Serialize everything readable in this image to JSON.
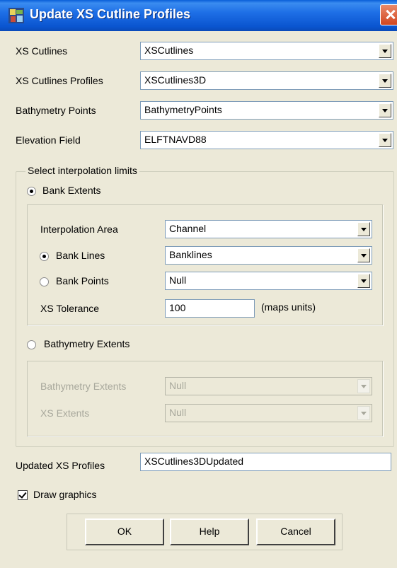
{
  "window": {
    "title": "Update XS Cutline Profiles"
  },
  "fields": {
    "xs_cutlines": {
      "label": "XS Cutlines",
      "value": "XSCutlines"
    },
    "xs_cutlines_profiles": {
      "label": "XS Cutlines Profiles",
      "value": "XSCutlines3D"
    },
    "bathymetry_points": {
      "label": "Bathymetry Points",
      "value": "BathymetryPoints"
    },
    "elevation_field": {
      "label": "Elevation Field",
      "value": "ELFTNAVD88"
    }
  },
  "interpolation": {
    "group_label": "Select interpolation limits",
    "bank_extents": {
      "label": "Bank Extents",
      "selected": true,
      "interpolation_area": {
        "label": "Interpolation Area",
        "value": "Channel"
      },
      "bank_lines": {
        "label": "Bank Lines",
        "value": "Banklines",
        "selected": true
      },
      "bank_points": {
        "label": "Bank Points",
        "value": "Null",
        "selected": false
      },
      "xs_tolerance": {
        "label": "XS Tolerance",
        "value": "100",
        "units": "(maps units)"
      }
    },
    "bathymetry_extents": {
      "label": "Bathymetry Extents",
      "selected": false,
      "bathymetry_extents_field": {
        "label": "Bathymetry Extents",
        "value": "Null"
      },
      "xs_extents": {
        "label": "XS Extents",
        "value": "Null"
      }
    }
  },
  "updated_profiles": {
    "label": "Updated XS Profiles",
    "value": "XSCutlines3DUpdated"
  },
  "draw_graphics": {
    "label": "Draw graphics",
    "checked": true
  },
  "buttons": {
    "ok": "OK",
    "help": "Help",
    "cancel": "Cancel"
  }
}
